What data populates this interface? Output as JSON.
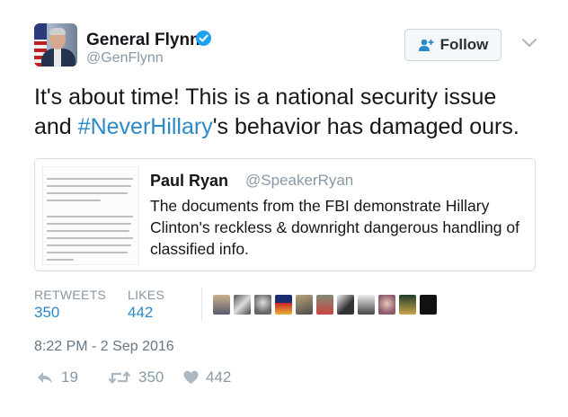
{
  "tweet": {
    "author": {
      "display_name": "General Flynn",
      "username": "@GenFlynn",
      "verified": true
    },
    "follow_button": {
      "label": "Follow",
      "icon": "add-user-icon"
    },
    "text": {
      "line1": "It's about time! This is a national security issue",
      "line2_prefix": "and ",
      "hashtag": "#NeverHillary",
      "line2_suffix": "'s behavior has damaged ours."
    },
    "quoted": {
      "display_name": "Paul Ryan",
      "username": "@SpeakerRyan",
      "text": "The documents from the FBI demonstrate Hillary Clinton's reckless & downright dangerous handling of classified info."
    },
    "stats": {
      "retweets_label": "RETWEETS",
      "retweets_count": "350",
      "likes_label": "LIKES",
      "likes_count": "442"
    },
    "liked_by_avatars": 10,
    "timestamp": "8:22 PM - 2 Sep 2016",
    "actions": {
      "reply_count": "19",
      "retweet_count": "350",
      "like_count": "442"
    },
    "colors": {
      "link": "#2a8ac8",
      "muted": "#8899a6",
      "verified": "#1da1f2"
    }
  }
}
